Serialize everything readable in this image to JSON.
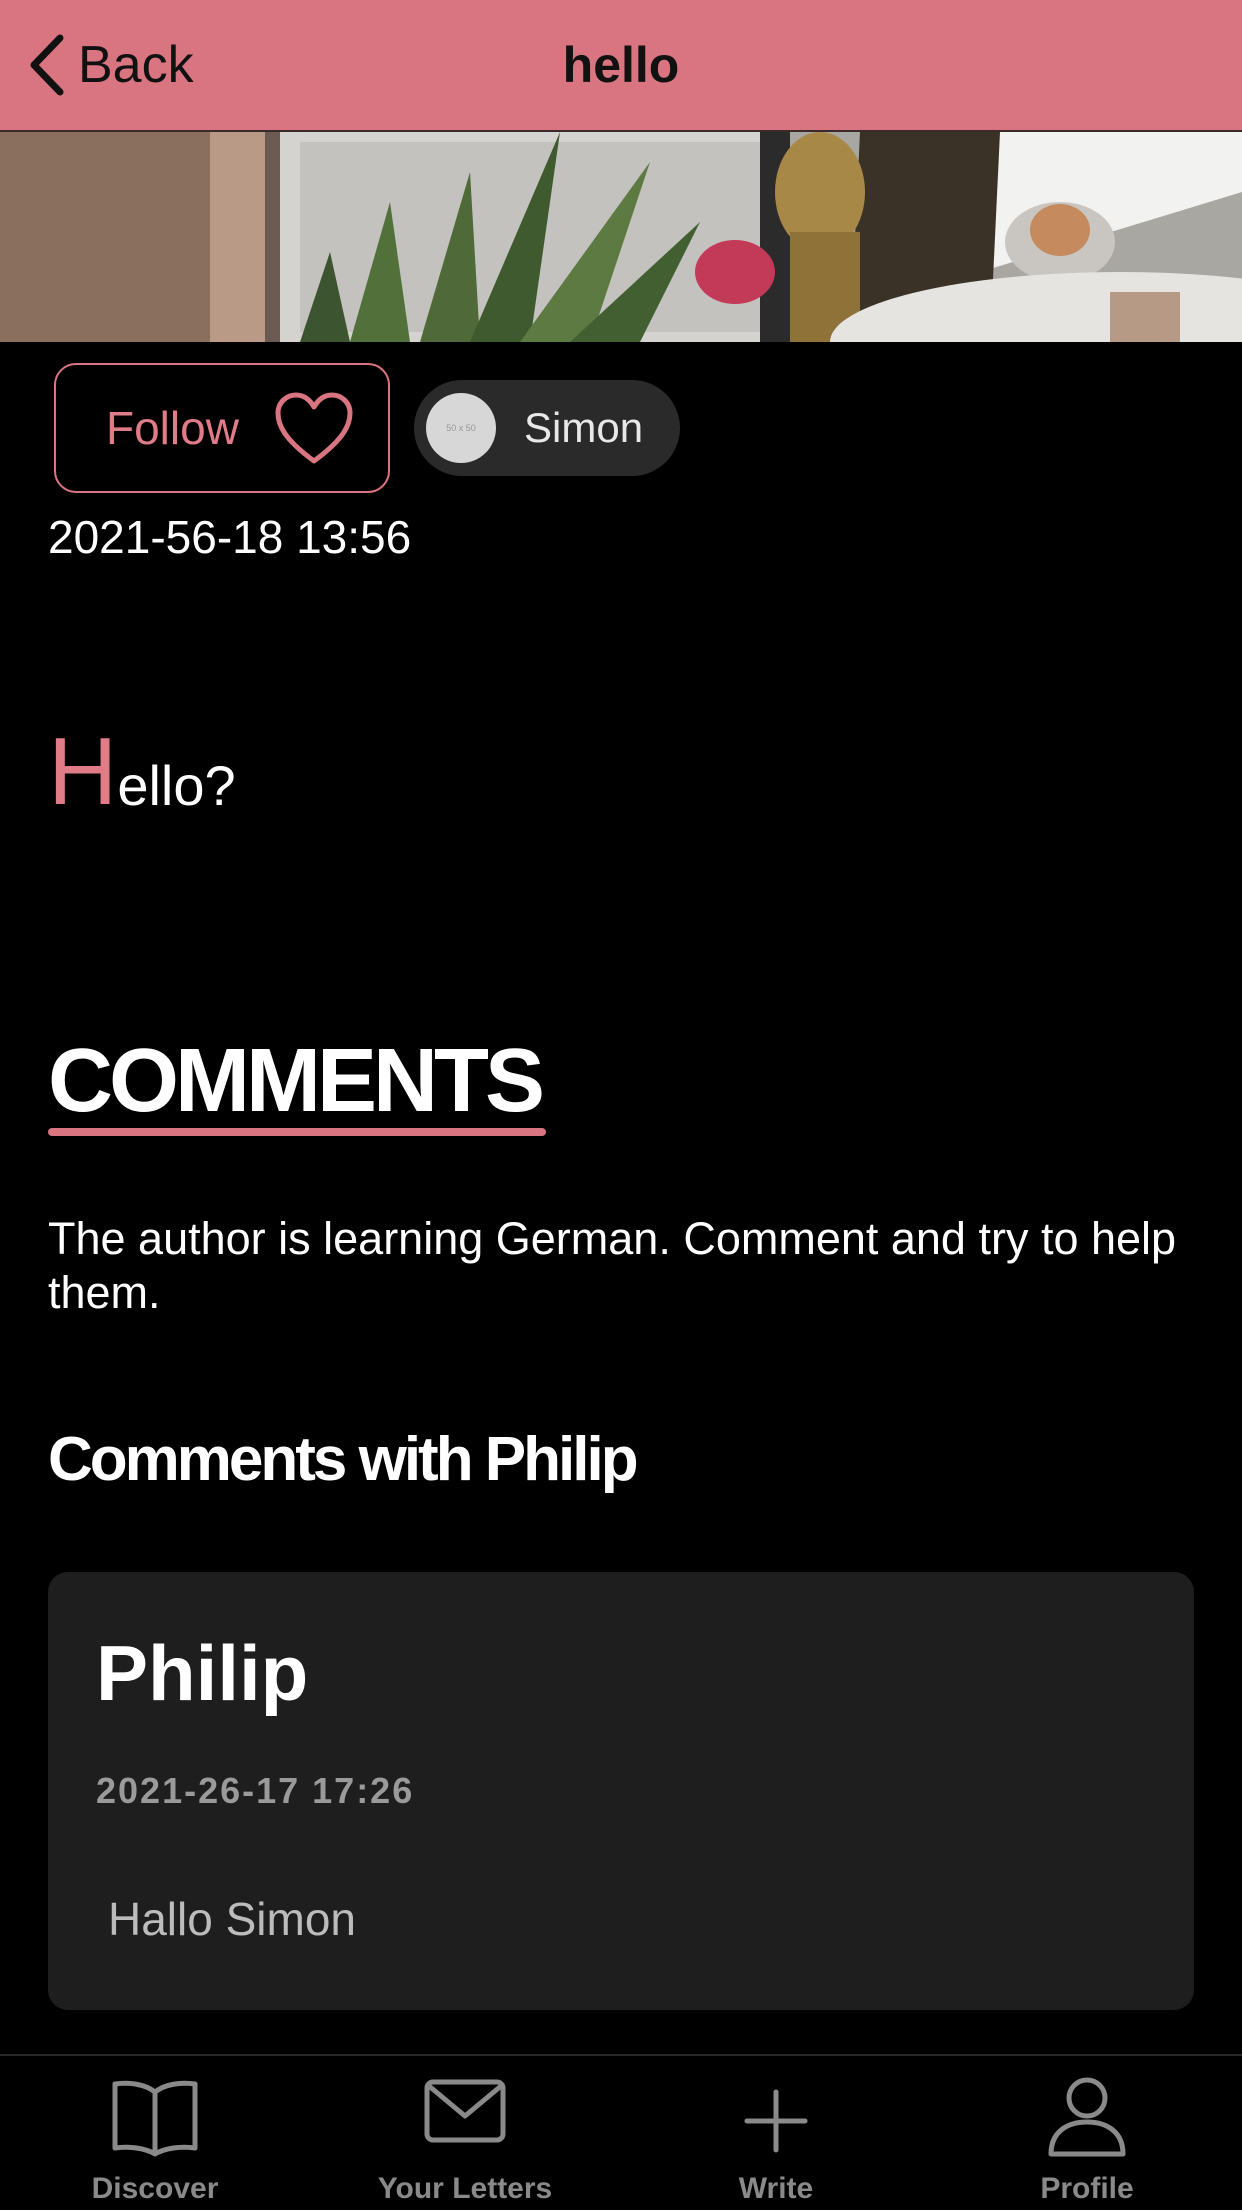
{
  "header": {
    "back_label": "Back",
    "title": "hello"
  },
  "post": {
    "follow_label": "Follow",
    "author_name": "Simon",
    "avatar_placeholder": "50 x 50",
    "date": "2021-56-18 13:56",
    "body_initial": "H",
    "body_rest": "ello?"
  },
  "comments": {
    "heading": "COMMENTS",
    "note": "The author is learning German. Comment and try to help them.",
    "thread_title": "Comments with Philip",
    "items": [
      {
        "author": "Philip",
        "date": "2021-26-17 17:26",
        "text": "Hallo Simon"
      }
    ]
  },
  "tabbar": {
    "items": [
      {
        "label": "Discover",
        "icon": "book-icon"
      },
      {
        "label": "Your Letters",
        "icon": "envelope-icon"
      },
      {
        "label": "Write",
        "icon": "plus-icon"
      },
      {
        "label": "Profile",
        "icon": "person-icon"
      }
    ]
  },
  "colors": {
    "accent": "#d97580",
    "background": "#000000",
    "card": "#1e1e1e",
    "tab_inactive": "#8a8a8a"
  }
}
